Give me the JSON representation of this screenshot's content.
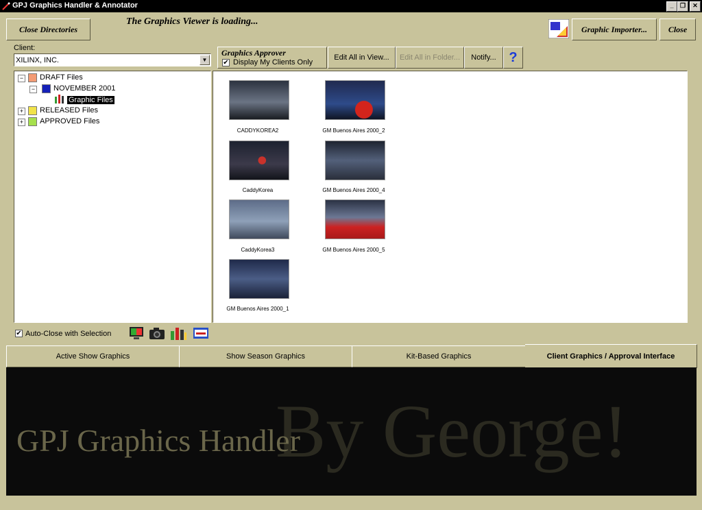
{
  "window": {
    "title": "GPJ Graphics Handler & Annotator"
  },
  "toolbar": {
    "close_directories": "Close Directories",
    "status": "The Graphics Viewer is loading...",
    "graphic_importer": "Graphic Importer...",
    "close": "Close"
  },
  "client": {
    "label": "Client:",
    "value": "XILINX, INC."
  },
  "approver": {
    "title": "Graphics Approver",
    "display_my_clients": "Display My Clients Only",
    "edit_all_view": "Edit All in View...",
    "edit_all_folder": "Edit All in Folder...",
    "notify": "Notify...",
    "help": "?"
  },
  "tree": {
    "draft": "DRAFT Files",
    "november": "NOVEMBER 2001",
    "graphic_files": "Graphic Files",
    "released": "RELEASED Files",
    "approved": "APPROVED Files"
  },
  "thumbnails": [
    {
      "caption": "CADDYKOREA2"
    },
    {
      "caption": "GM Buenos Aires 2000_2"
    },
    {
      "caption": "CaddyKorea"
    },
    {
      "caption": "GM Buenos Aires 2000_4"
    },
    {
      "caption": "CaddyKorea3"
    },
    {
      "caption": "GM Buenos Aires 2000_5"
    },
    {
      "caption": "GM Buenos Aires 2000_1"
    }
  ],
  "options": {
    "auto_close": "Auto-Close with Selection"
  },
  "tabs": [
    {
      "label": "Active Show Graphics"
    },
    {
      "label": "Show Season Graphics"
    },
    {
      "label": "Kit-Based Graphics"
    },
    {
      "label": "Client Graphics / Approval Interface"
    }
  ],
  "banner": {
    "left": "GPJ Graphics Handler",
    "right": "By George!"
  }
}
